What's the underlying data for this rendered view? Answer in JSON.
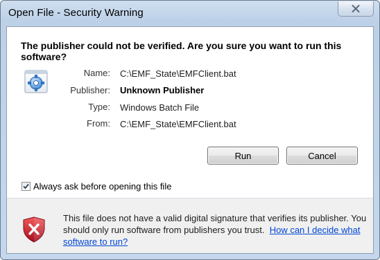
{
  "window": {
    "title": "Open File - Security Warning"
  },
  "warning": {
    "heading": "The publisher could not be verified.  Are you sure you want to run this software?"
  },
  "file_info": {
    "rows": [
      {
        "label": "Name:",
        "value": "C:\\EMF_State\\EMFClient.bat",
        "bold": false
      },
      {
        "label": "Publisher:",
        "value": "Unknown Publisher",
        "bold": true
      },
      {
        "label": "Type:",
        "value": "Windows Batch File",
        "bold": false
      },
      {
        "label": "From:",
        "value": "C:\\EMF_State\\EMFClient.bat",
        "bold": false
      }
    ]
  },
  "buttons": {
    "run_label": "Run",
    "cancel_label": "Cancel"
  },
  "checkbox": {
    "label": "Always ask before opening this file",
    "checked": true
  },
  "footer": {
    "text": "This file does not have a valid digital signature that verifies its publisher.  You should only run software from publishers you trust.",
    "link_text": "How can I decide what software to run?"
  },
  "icons": {
    "close": "close-icon",
    "file": "gear-file-icon",
    "shield": "security-shield-icon",
    "checkmark": "checkmark-icon"
  },
  "colors": {
    "link": "#0046d5",
    "shield_red": "#c8102e",
    "title_bar": "#bcd0e7"
  }
}
